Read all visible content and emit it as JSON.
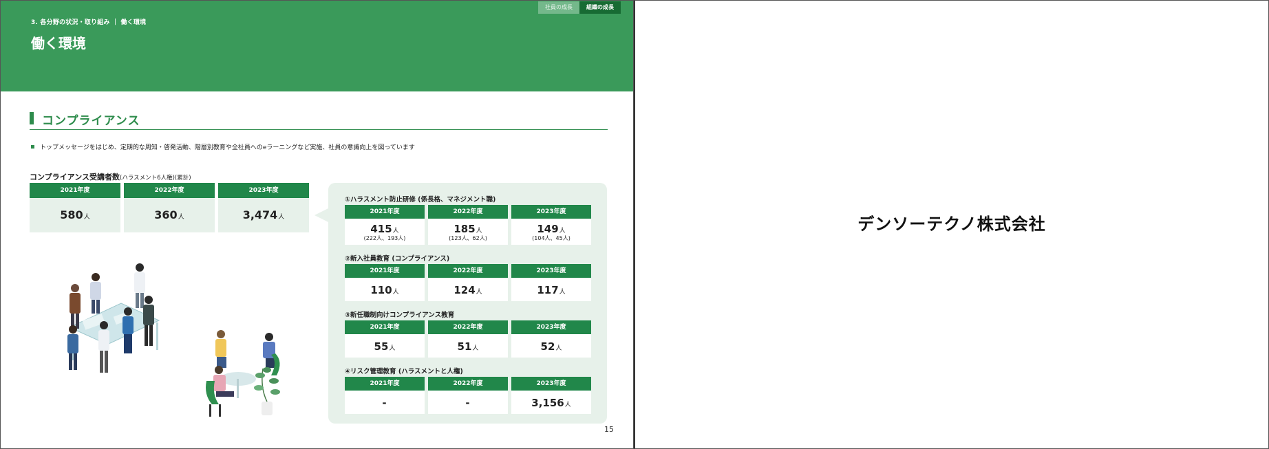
{
  "header": {
    "breadcrumb": "3. 各分野の状況・取り組み ｜ 働く環境",
    "title": "働く環境",
    "tabs": [
      {
        "label": "社員の成長",
        "active": false
      },
      {
        "label": "組織の成長",
        "active": true
      }
    ]
  },
  "section": {
    "title": "コンプライアンス",
    "bullet": "トップメッセージをはじめ、定期的な周知・啓発活動、階層別教育や全社員へのeラーニングなど実施、社員の意識向上を図っています"
  },
  "main_stats": {
    "title": "コンプライアンス受講者数",
    "note": "(ハラスメント6人権)(累計)",
    "items": [
      {
        "year": "2021年度",
        "value": "580",
        "unit": "人"
      },
      {
        "year": "2022年度",
        "value": "360",
        "unit": "人"
      },
      {
        "year": "2023年度",
        "value": "3,474",
        "unit": "人"
      }
    ]
  },
  "panel": {
    "groups": [
      {
        "title": "①ハラスメント防止研修 (係長格、マネジメント職)",
        "items": [
          {
            "year": "2021年度",
            "value": "415",
            "unit": "人",
            "sub": "(222人、193人)"
          },
          {
            "year": "2022年度",
            "value": "185",
            "unit": "人",
            "sub": "(123人、62人)"
          },
          {
            "year": "2023年度",
            "value": "149",
            "unit": "人",
            "sub": "(104人、45人)"
          }
        ]
      },
      {
        "title": "②新入社員教育 (コンプライアンス)",
        "items": [
          {
            "year": "2021年度",
            "value": "110",
            "unit": "人"
          },
          {
            "year": "2022年度",
            "value": "124",
            "unit": "人"
          },
          {
            "year": "2023年度",
            "value": "117",
            "unit": "人"
          }
        ]
      },
      {
        "title": "③新任職制向けコンプライアンス教育",
        "items": [
          {
            "year": "2021年度",
            "value": "55",
            "unit": "人"
          },
          {
            "year": "2022年度",
            "value": "51",
            "unit": "人"
          },
          {
            "year": "2023年度",
            "value": "52",
            "unit": "人"
          }
        ]
      },
      {
        "title": "④リスク管理教育 (ハラスメントと人権)",
        "items": [
          {
            "year": "2021年度",
            "value": "-",
            "unit": ""
          },
          {
            "year": "2022年度",
            "value": "-",
            "unit": ""
          },
          {
            "year": "2023年度",
            "value": "3,156",
            "unit": "人"
          }
        ]
      }
    ]
  },
  "page_number": "15",
  "right_page": {
    "company": "デンソーテクノ株式会社"
  },
  "colors": {
    "brand_green": "#3a9a5a",
    "dark_green": "#21874a",
    "light_green": "#e7f1ea"
  }
}
